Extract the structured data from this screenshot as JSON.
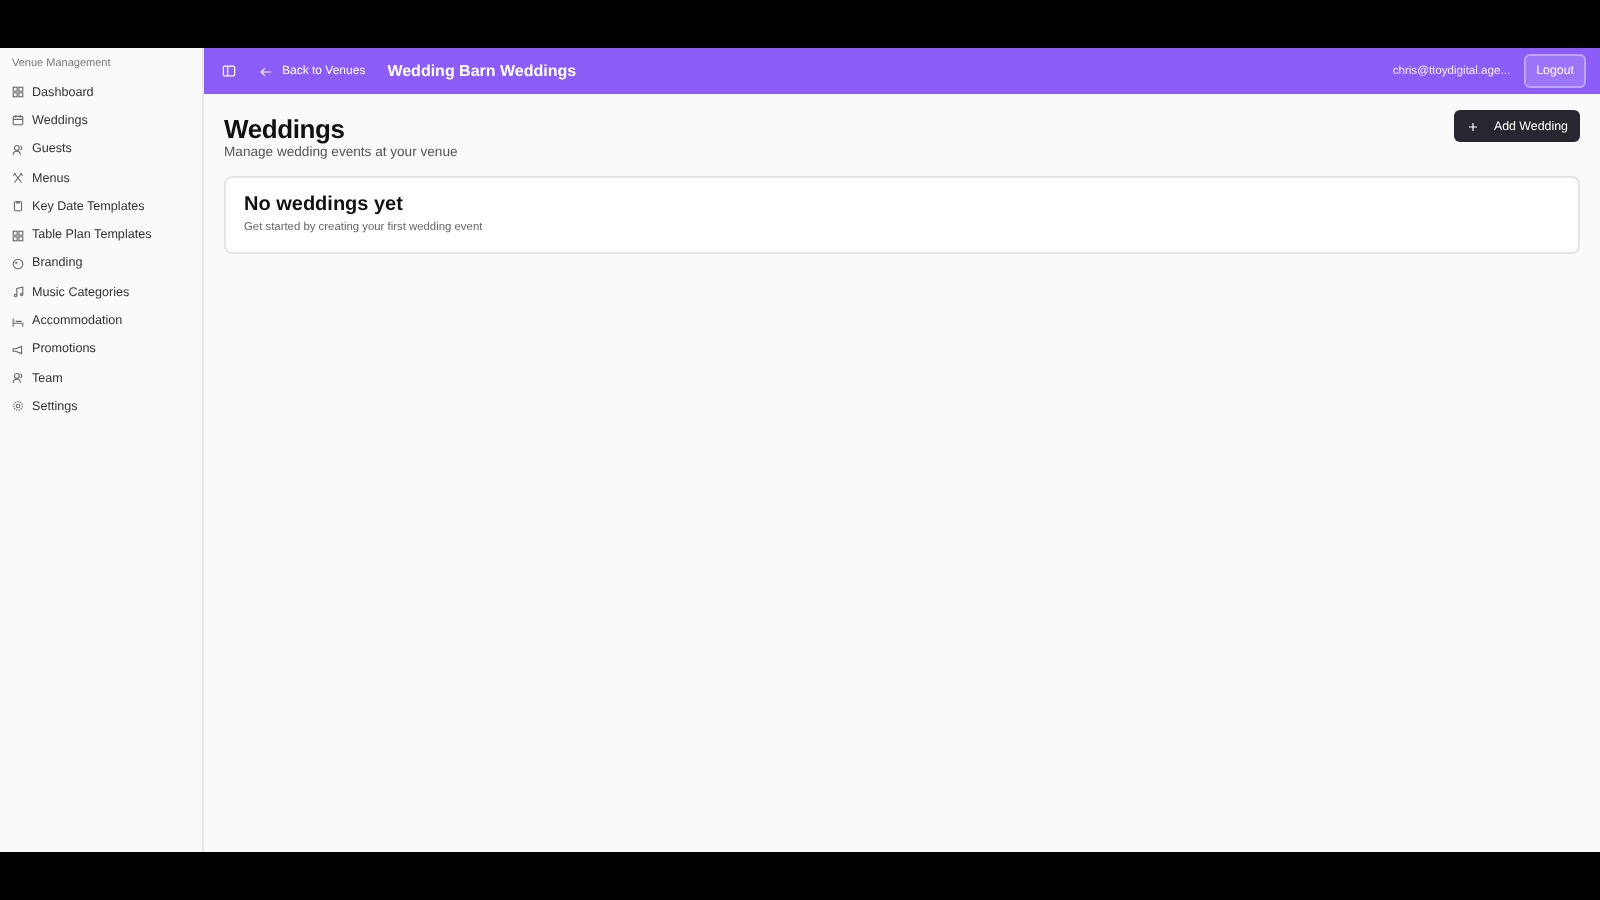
{
  "sidebar": {
    "heading": "Venue Management",
    "items": [
      {
        "label": "Dashboard",
        "selected": false
      },
      {
        "label": "Weddings",
        "selected": false
      },
      {
        "label": "Guests",
        "selected": false
      },
      {
        "label": "Menus",
        "selected": false
      },
      {
        "label": "Key Date Templates",
        "selected": false
      },
      {
        "label": "Table Plan Templates",
        "selected": false
      },
      {
        "label": "Branding",
        "selected": false
      },
      {
        "label": "Music Categories",
        "selected": false
      },
      {
        "label": "Accommodation",
        "selected": false
      },
      {
        "label": "Promotions",
        "selected": false
      },
      {
        "label": "Team",
        "selected": false
      },
      {
        "label": "Settings",
        "selected": false
      }
    ]
  },
  "header": {
    "back_link": "Back to Venues",
    "title": "Wedding Barn Weddings",
    "user_email": "chris@ttoydigital.age...",
    "logout_button": "Logout"
  },
  "page": {
    "title": "Weddings",
    "subtitle": "Manage wedding events at your venue",
    "add_button": "Add Wedding"
  },
  "empty_state": {
    "title": "No weddings yet",
    "message": "Get started by creating your first wedding event"
  }
}
